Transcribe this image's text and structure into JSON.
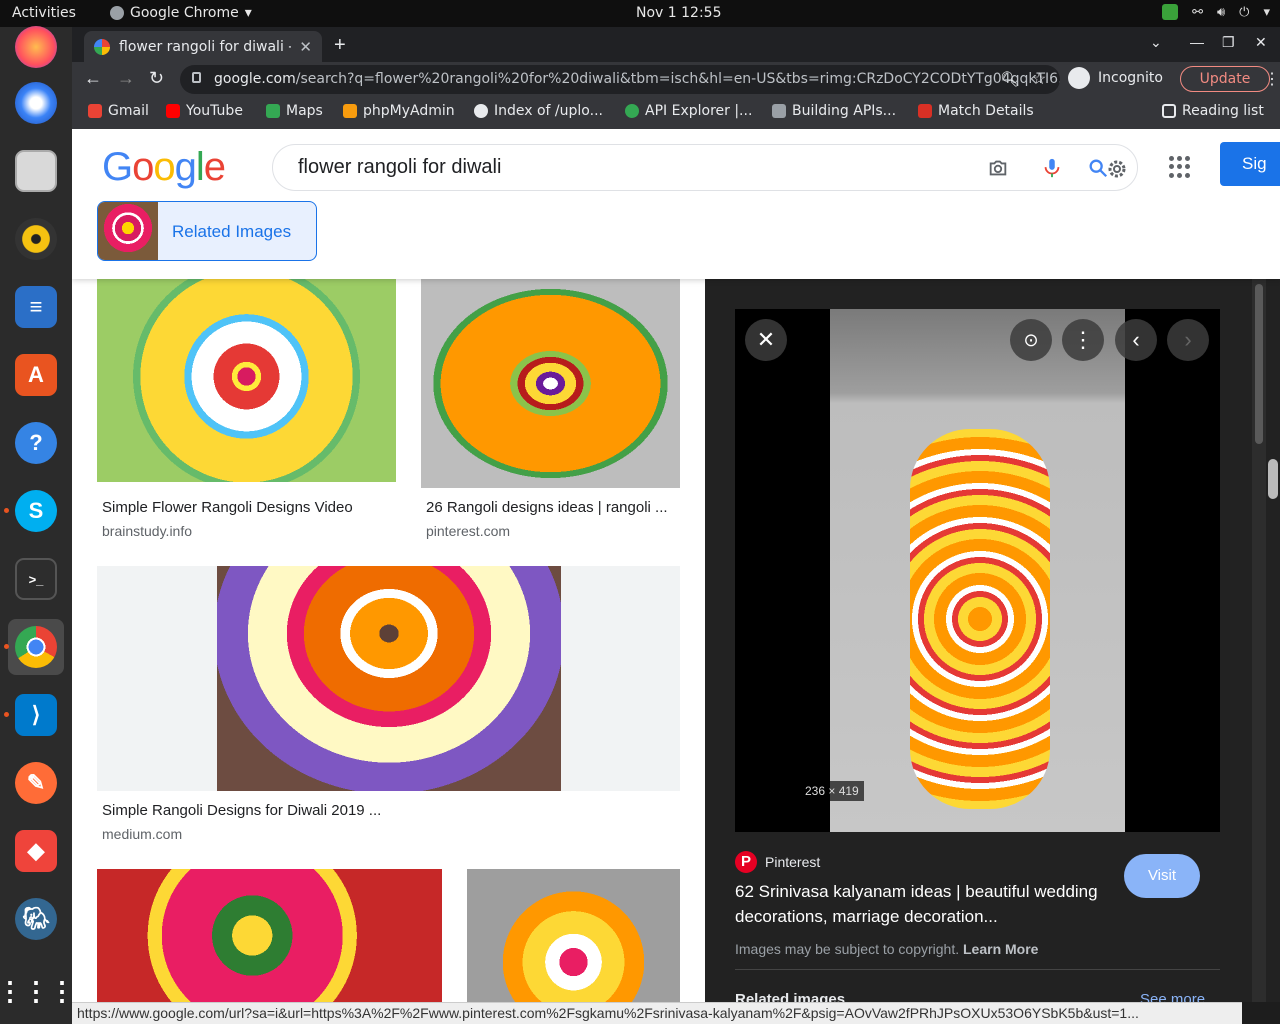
{
  "system": {
    "activities": "Activities",
    "app_menu": "Google Chrome",
    "clock": "Nov 1  12:55"
  },
  "dock": {
    "items": [
      "firefox",
      "thunderbird",
      "files",
      "rhythmbox",
      "libreoffice-writer",
      "software-center",
      "help",
      "skype",
      "terminal",
      "chrome",
      "vscode",
      "postman",
      "anydesk",
      "pgadmin",
      "show-applications"
    ]
  },
  "browser": {
    "tab_title": "flower rangoli for diwali - ",
    "address": {
      "host": "google.com",
      "path": "/search?q=flower%20rangoli%20for%20diwali&tbm=isch&hl=en-US&tbs=rimg:CRzDoCY2CODtYTg04qqkTI6..."
    },
    "incognito_label": "Incognito",
    "update_label": "Update",
    "bookmarks": [
      {
        "label": "Gmail",
        "color": "#ea4335"
      },
      {
        "label": "YouTube",
        "color": "#ff0000"
      },
      {
        "label": "Maps",
        "color": "#34a853"
      },
      {
        "label": "phpMyAdmin",
        "color": "#f89c0e"
      },
      {
        "label": "Index of /uplo...",
        "color": "#e8eaed"
      },
      {
        "label": "API Explorer |...",
        "color": "#34a853"
      },
      {
        "label": "Building APIs...",
        "color": "#9aa0a6"
      },
      {
        "label": "Match Details",
        "color": "#d93025"
      }
    ],
    "reading_list": "Reading list",
    "status_url": "https://www.google.com/url?sa=i&url=https%3A%2F%2Fwww.pinterest.com%2Fsgkamu%2Fsrinivasa-kalyanam%2F&psig=AOvVaw2fPRhJPsOXUx53O6YSbK5b&ust=1..."
  },
  "google": {
    "logo": "Google",
    "query": "flower rangoli for diwali",
    "signin_label": "Sig",
    "related_chip": "Related Images"
  },
  "results": [
    {
      "title": "Simple Flower Rangoli Designs Video",
      "source": "brainstudy.info"
    },
    {
      "title": "26 Rangoli designs ideas | rangoli ...",
      "source": "pinterest.com"
    },
    {
      "title": "Simple Rangoli Designs for Diwali 2019 ...",
      "source": "medium.com"
    }
  ],
  "viewer": {
    "dimensions": "236 × 419",
    "source_name": "Pinterest",
    "title": "62 Srinivasa kalyanam ideas | beautiful wedding decorations, marriage decoration...",
    "visit_label": "Visit",
    "copyright_text": "Images may be subject to copyright.",
    "learn_more": "Learn More",
    "related_heading": "Related images",
    "see_more": "See more"
  }
}
